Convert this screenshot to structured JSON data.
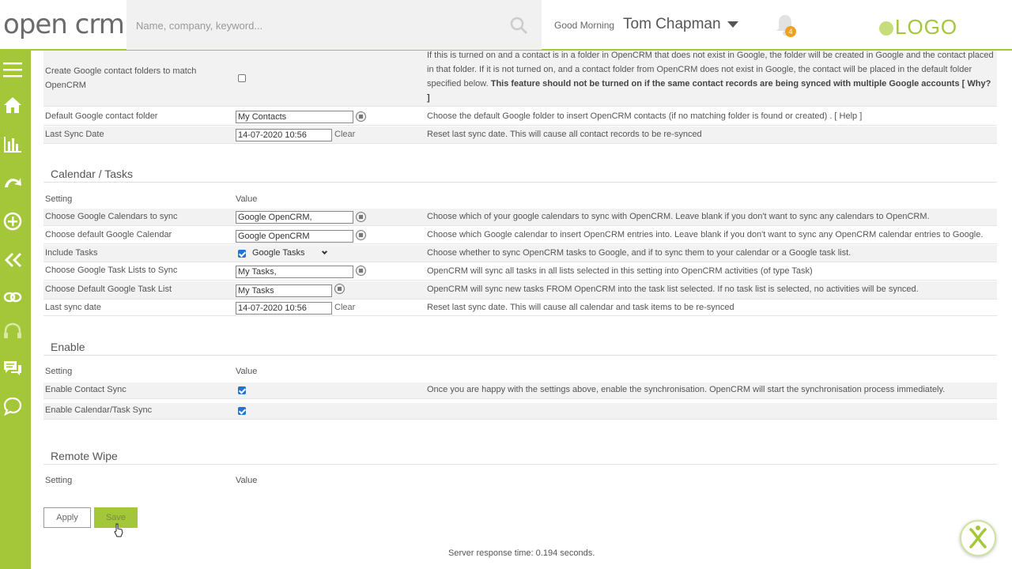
{
  "header": {
    "logo_text_a": "op",
    "logo_text_b": "en crm",
    "search_placeholder": "Name, company, keyword...",
    "greeting": "Good Morning",
    "user_name": "Tom Chapman",
    "notification_count": "4",
    "brand_logo": "LOGO"
  },
  "sidebar": {
    "icons": [
      "menu-icon",
      "home-icon",
      "bar-chart-icon",
      "pipeline-icon",
      "add-icon",
      "collapse-icon",
      "link-icon",
      "headset-icon",
      "chat-icon",
      "speech-bubble-icon"
    ]
  },
  "contacts_rows": {
    "folder_sync": {
      "label": "Create Google contact folders to match OpenCRM",
      "checked": false,
      "desc_plain": "If this is turned on and a contact is in a folder in OpenCRM that does not exist in Google, the folder will be created in Google and the contact placed in that folder. If it is not turned on, and a contact folder from OpenCRM does not exist in Google, the contact will be placed in the default folder specified below. ",
      "desc_bold": "This feature should not be turned on if the same contact records are being synced with multiple Google accounts [ Why? ]"
    },
    "default_folder": {
      "label": "Default Google contact folder",
      "value": "My Contacts",
      "desc": "Choose the default Google folder to insert OpenCRM contacts (if no matching folder is found or created) . [ Help ]"
    },
    "last_sync": {
      "label": "Last Sync Date",
      "value": "14-07-2020 10:56",
      "clear": "Clear",
      "desc": "Reset last sync date. This will cause all contact records to be re-synced"
    }
  },
  "calendar": {
    "title": "Calendar / Tasks",
    "setting_header": "Setting",
    "value_header": "Value",
    "rows": {
      "calendars": {
        "label": "Choose Google Calendars to sync",
        "value": "Google OpenCRM,",
        "desc": "Choose which of your google calendars to sync with OpenCRM. Leave blank if you don't want to sync any calendars to OpenCRM."
      },
      "default_calendar": {
        "label": "Choose default Google Calendar",
        "value": "Google OpenCRM",
        "desc": "Choose which Google calendar to insert OpenCRM entries into. Leave blank if you don't want to sync any OpenCRM calendar entries to Google."
      },
      "include_tasks": {
        "label": "Include Tasks",
        "checked": true,
        "select": "Google Tasks",
        "desc": "Choose whether to sync OpenCRM tasks to Google, and if to sync them to your calendar or a Google task list."
      },
      "task_lists": {
        "label": "Choose Google Task Lists to Sync",
        "value": "My Tasks,",
        "desc": "OpenCRM will sync all tasks in all lists selected in this setting into OpenCRM activities (of type Task)"
      },
      "default_task_list": {
        "label": "Choose Default Google Task List",
        "value": "My Tasks",
        "desc": "OpenCRM will sync new tasks FROM OpenCRM into the task list selected. If no task list is selected, no activities will be synced."
      },
      "last_sync": {
        "label": "Last sync date",
        "value": "14-07-2020 10:56",
        "clear": "Clear",
        "desc": "Reset last sync date. This will cause all calendar and task items to be re-synced"
      }
    }
  },
  "enable": {
    "title": "Enable",
    "setting_header": "Setting",
    "value_header": "Value",
    "contact_sync": {
      "label": "Enable Contact Sync",
      "checked": true,
      "desc": "Once you are happy with the settings above, enable the synchronisation. OpenCRM will start the synchronisation process immediately."
    },
    "calendar_sync": {
      "label": "Enable Calendar/Task Sync",
      "checked": true
    }
  },
  "remote_wipe": {
    "title": "Remote Wipe",
    "setting_header": "Setting",
    "value_header": "Value"
  },
  "actions": {
    "apply": "Apply",
    "save": "Save"
  },
  "footer": {
    "response_time": "Server response time: 0.194 seconds."
  },
  "colors": {
    "brand_green": "#a4c639",
    "checkbox_blue": "#2174d0",
    "notification_orange": "#f0a020"
  }
}
